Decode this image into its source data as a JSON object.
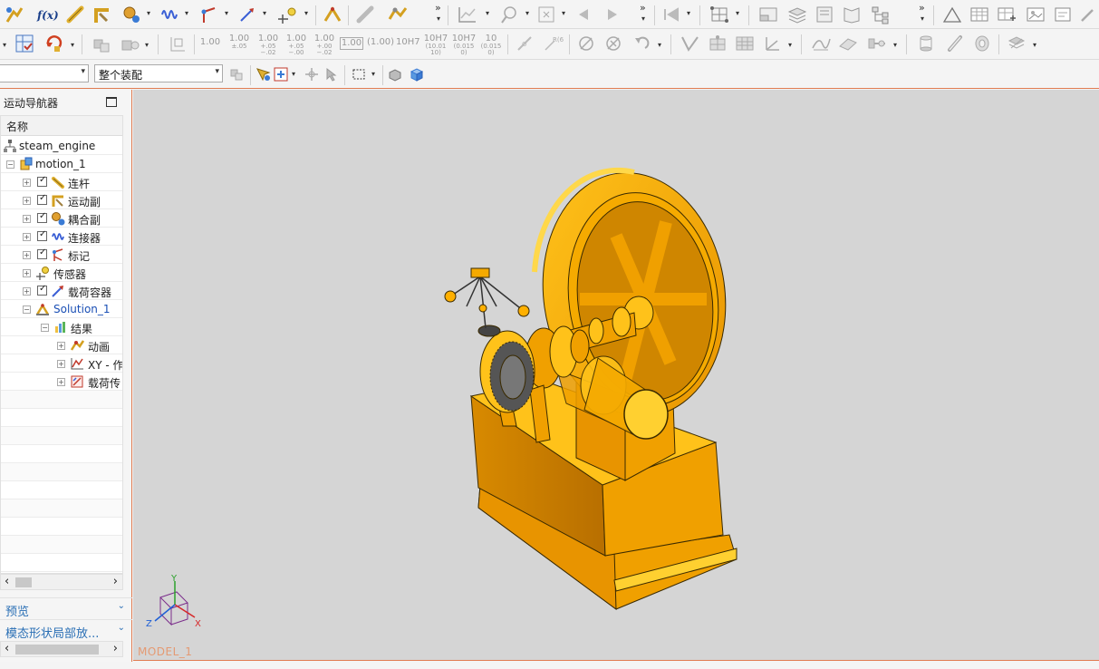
{
  "toolbar": {
    "row2_dims": [
      "1.00",
      "1.00",
      "1.00",
      "1.00",
      "1.00",
      "1.00",
      "(1.00)",
      "10H7",
      "10H7",
      "10H7",
      "10"
    ],
    "row2_dim_subs": [
      "",
      "±.05",
      "+.05 −.02",
      "+.05 −.00",
      "+.00 −.02",
      "",
      "",
      "",
      "(10.01 10)",
      "(0.015 0)",
      "(0.015 0)"
    ],
    "filter_value": "",
    "assembly_value": "整个装配",
    "overflow_glyph": "»",
    "dropdown_glyph": "▾"
  },
  "navigator": {
    "title": "运动导航器",
    "column_header": "名称",
    "rows": [
      {
        "label": "steam_engine"
      },
      {
        "label": "motion_1"
      },
      {
        "label": "连杆"
      },
      {
        "label": "运动副"
      },
      {
        "label": "耦合副"
      },
      {
        "label": "连接器"
      },
      {
        "label": "标记"
      },
      {
        "label": "传感器"
      },
      {
        "label": "载荷容器"
      },
      {
        "label": "Solution_1"
      },
      {
        "label": "结果"
      },
      {
        "label": "动画"
      },
      {
        "label": "XY - 作"
      },
      {
        "label": "载荷传"
      }
    ],
    "scroll_left": "‹",
    "scroll_right": "›"
  },
  "panels": {
    "preview": "预览",
    "modal_shapes": "模态形状局部放...",
    "chevron": "⌄"
  },
  "viewport": {
    "model_name": "MODEL_1",
    "axis_x": "X",
    "axis_y": "Y",
    "axis_z": "Z"
  },
  "colors": {
    "model_fill": "#f5a800",
    "model_dark": "#c77a00",
    "viewport_bg": "#d5d5d5",
    "accent_border": "#e07c52",
    "link_blue": "#1a4fb5"
  }
}
